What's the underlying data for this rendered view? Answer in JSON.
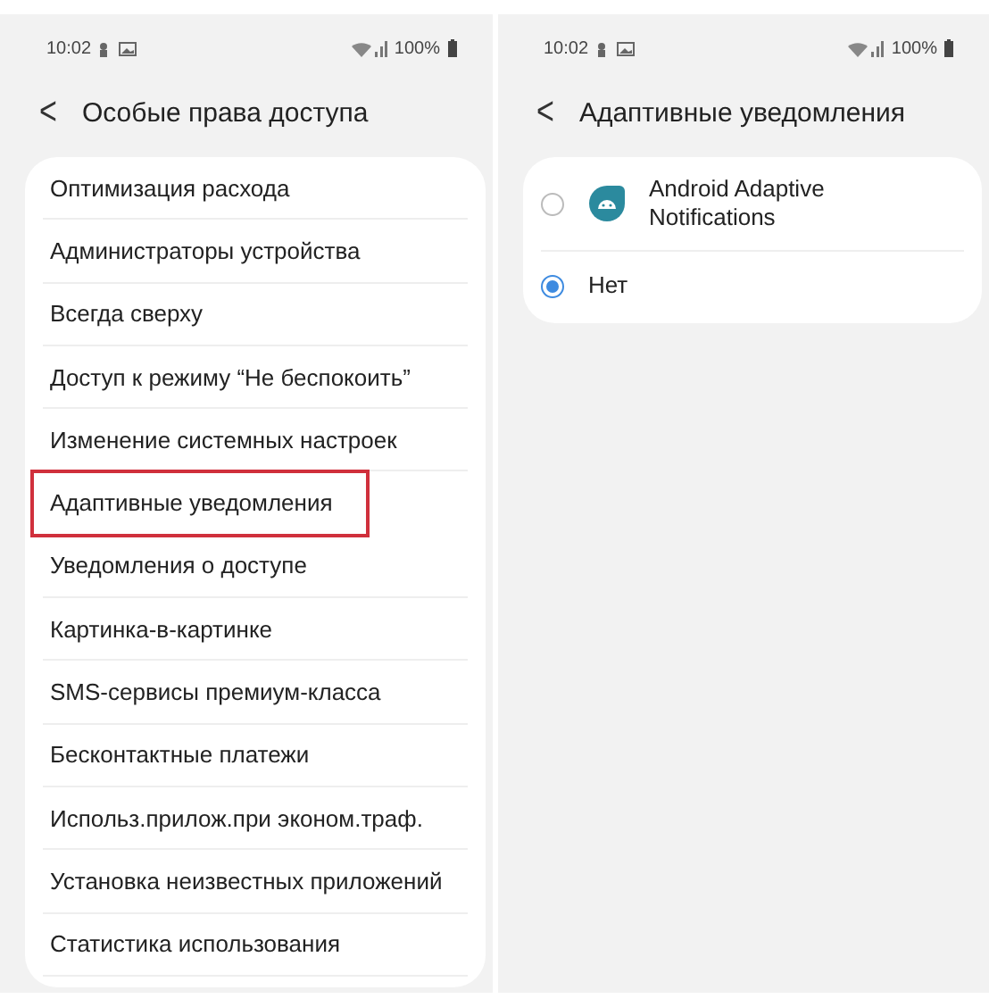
{
  "screens": [
    {
      "status_bar": {
        "time": "10:02",
        "battery": "100%"
      },
      "header": {
        "back": "<",
        "title": "Особые права доступа"
      },
      "kind": "list",
      "items": [
        {
          "label": "Оптимизация расхода",
          "highlighted": false
        },
        {
          "label": "Администраторы устройства",
          "highlighted": false
        },
        {
          "label": "Всегда сверху",
          "highlighted": false
        },
        {
          "label": "Доступ к режиму “Не беспокоить”",
          "highlighted": false
        },
        {
          "label": "Изменение системных настроек",
          "highlighted": false
        },
        {
          "label": "Адаптивные уведомления",
          "highlighted": true
        },
        {
          "label": "Уведомления о доступе",
          "highlighted": false
        },
        {
          "label": "Картинка-в-картинке",
          "highlighted": false
        },
        {
          "label": "SMS-сервисы премиум-класса",
          "highlighted": false
        },
        {
          "label": "Бесконтактные платежи",
          "highlighted": false
        },
        {
          "label": "Использ.прилож.при эконом.траф.",
          "highlighted": false
        },
        {
          "label": "Установка неизвестных приложений",
          "highlighted": false
        },
        {
          "label": "Статистика использования",
          "highlighted": false
        }
      ]
    },
    {
      "status_bar": {
        "time": "10:02",
        "battery": "100%"
      },
      "header": {
        "back": "<",
        "title": "Адаптивные уведомления"
      },
      "kind": "radio",
      "items": [
        {
          "label": "Android Adaptive Notifications",
          "selected": false,
          "app_icon": true
        },
        {
          "label": "Нет",
          "selected": true,
          "app_icon": false
        }
      ]
    }
  ]
}
